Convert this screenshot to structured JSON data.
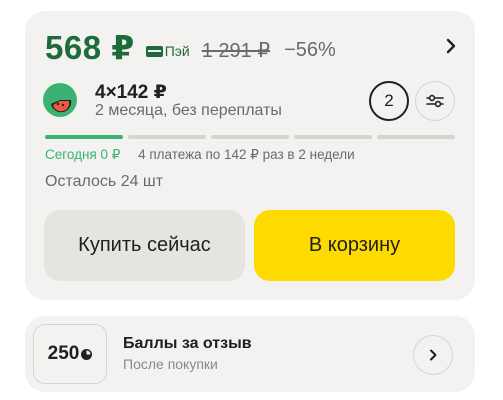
{
  "price": {
    "current": "568 ₽",
    "pay_label": "Пэй",
    "old": "1 291 ₽",
    "discount": "−56%"
  },
  "split": {
    "amount": "4×142 ₽",
    "description": "2 месяца, без переплаты",
    "months": "2",
    "segments": 5,
    "active_segments": 1
  },
  "schedule": {
    "today": "Сегодня 0 ₽",
    "plan": "4 платежа по 142 ₽ раз в 2 недели"
  },
  "stock": "Осталось 24 шт",
  "buttons": {
    "buy_now": "Купить сейчас",
    "add_to_cart": "В корзину"
  },
  "bonus": {
    "value": "250",
    "title": "Баллы за отзыв",
    "subtitle": "После покупки"
  },
  "colors": {
    "price_green": "#1e6b3a",
    "split_green": "#3bb271",
    "cart_yellow": "#fedb00",
    "card_bg": "#f3f2f1"
  },
  "icons": {
    "split_logo": "split-logo-icon",
    "settings": "sliders-icon",
    "chevron": "chevron-right-icon",
    "coin": "coin-icon"
  }
}
